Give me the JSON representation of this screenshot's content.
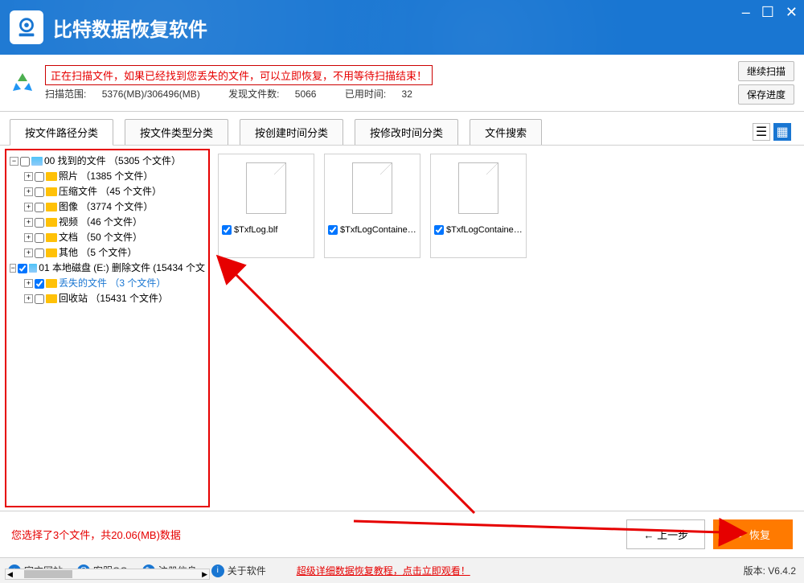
{
  "app": {
    "title": "比特数据恢复软件"
  },
  "scan": {
    "message": "正在扫描文件，如果已经找到您丢失的文件，可以立即恢复，不用等待扫描结束！",
    "range_label": "扫描范围:",
    "range": "5376(MB)/306496(MB)",
    "found_label": "发现文件数:",
    "found": "5066",
    "elapsed_label": "已用时间:",
    "elapsed": "32",
    "btn_continue": "继续扫描",
    "btn_save": "保存进度"
  },
  "tabs": [
    "按文件路径分类",
    "按文件类型分类",
    "按创建时间分类",
    "按修改时间分类",
    "文件搜索"
  ],
  "tree": {
    "root1": "00 找到的文件 （5305 个文件）",
    "c1": "照片   （1385 个文件）",
    "c2": "压缩文件   （45 个文件）",
    "c3": "图像   （3774 个文件）",
    "c4": "视频   （46 个文件）",
    "c5": "文档   （50 个文件）",
    "c6": "其他   （5 个文件）",
    "root2": "01 本地磁盘 (E:) 删除文件 (15434 个文",
    "d1": "丢失的文件   （3 个文件）",
    "d2": "回收站   （15431 个文件）"
  },
  "files": [
    {
      "name": "$TxfLog.blf"
    },
    {
      "name": "$TxfLogContainer..."
    },
    {
      "name": "$TxfLogContainer..."
    }
  ],
  "selection": "您选择了3个文件，共20.06(MB)数据",
  "btns": {
    "prev": "← 上一步",
    "recover": "恢复"
  },
  "footer": {
    "site": "官方网站",
    "qq": "客服QQ",
    "reg": "注册信息",
    "about": "关于软件",
    "tutorial": "超级详细数据恢复教程，点击立即观看！",
    "version": "版本: V6.4.2"
  }
}
